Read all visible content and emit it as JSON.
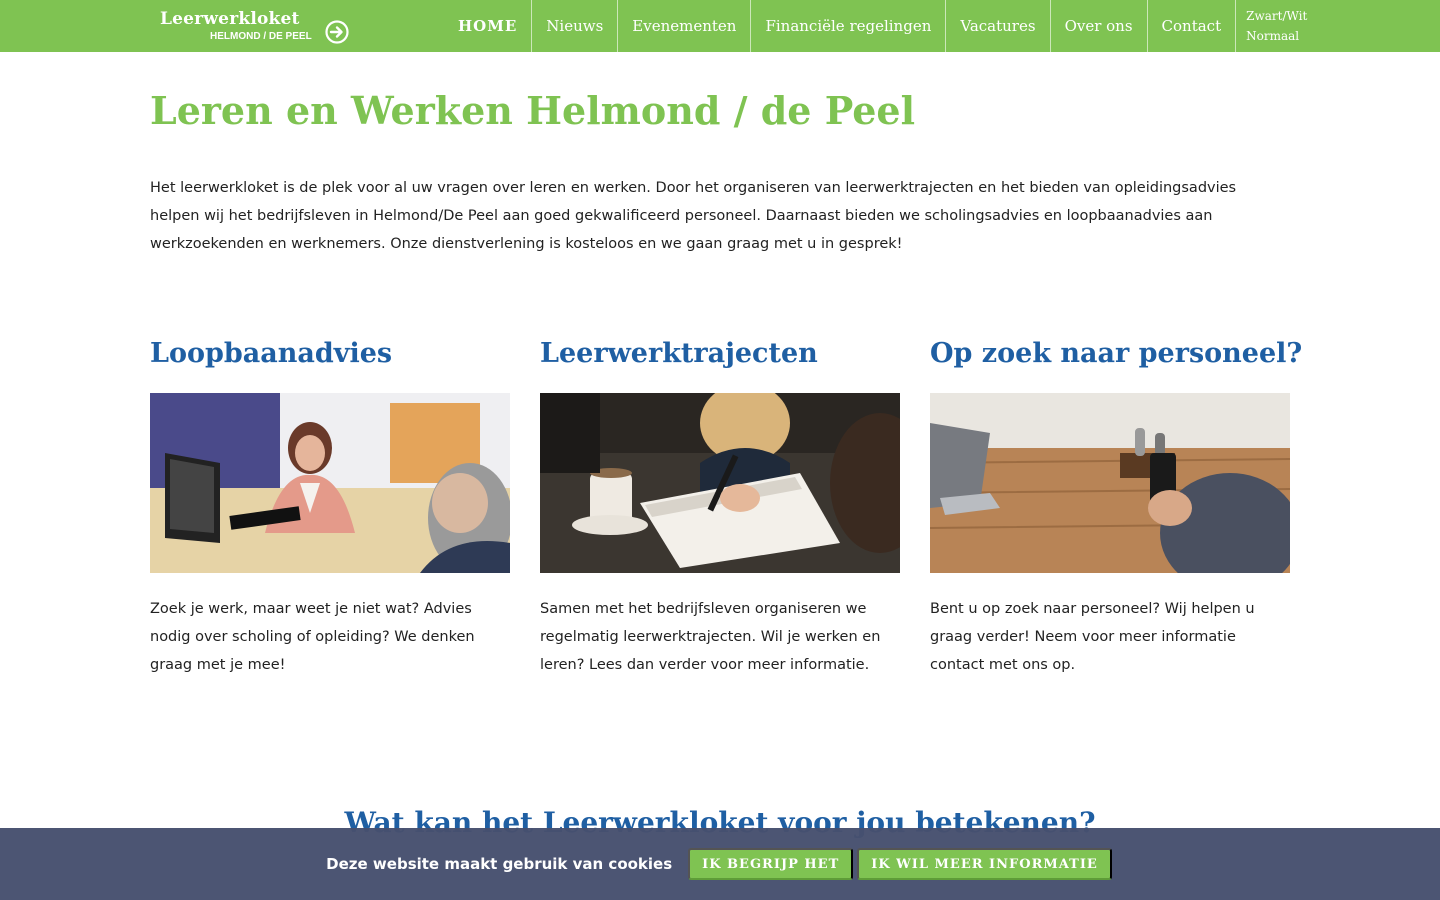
{
  "header": {
    "logo": {
      "title": "Leerwerkloket",
      "subtitle": "HELMOND / DE PEEL"
    },
    "nav": [
      {
        "label": "HOME",
        "active": true
      },
      {
        "label": "Nieuws"
      },
      {
        "label": "Evenementen"
      },
      {
        "label": "Financiële regelingen"
      },
      {
        "label": "Vacatures"
      },
      {
        "label": "Over ons"
      },
      {
        "label": "Contact"
      }
    ],
    "contrast": {
      "option_bw": "Zwart/Wit",
      "option_normal": "Normaal"
    }
  },
  "main": {
    "title": "Leren en Werken Helmond / de Peel",
    "intro": "Het leerwerkloket is de plek voor al uw vragen over leren en werken. Door het organiseren van leerwerktrajecten en het bieden van opleidingsadvies helpen wij het bedrijfsleven in Helmond/De Peel aan goed gekwalificeerd personeel. Daarnaast bieden we scholingsadvies en loopbaanadvies aan werkzoekenden en werknemers. Onze dienstverlening is kosteloos en we gaan graag met u in gesprek!",
    "cards": [
      {
        "title": "Loopbaanadvies",
        "text": "Zoek je werk, maar weet je niet wat? Advies nodig over scholing of opleiding? We denken graag met je mee!"
      },
      {
        "title": "Leerwerktrajecten",
        "text": "Samen met het bedrijfsleven organiseren we regelmatig leerwerktrajecten. Wil je werken en leren? Lees dan verder voor meer informatie."
      },
      {
        "title": "Op zoek naar personeel?",
        "text": "Bent u op zoek naar personeel? Wij helpen u graag verder! Neem voor meer informatie contact met ons op."
      }
    ],
    "section_heading": "Wat kan het Leerwerkloket voor jou betekenen?"
  },
  "cookie_bar": {
    "text": "Deze website maakt gebruik van cookies",
    "accept_label": "IK BEGRIJP HET",
    "more_label": "IK WIL MEER INFORMATIE"
  },
  "colors": {
    "brand_green": "#7fc352",
    "heading_blue": "#1f5fa3",
    "cookie_bar_bg": "#46506e"
  }
}
